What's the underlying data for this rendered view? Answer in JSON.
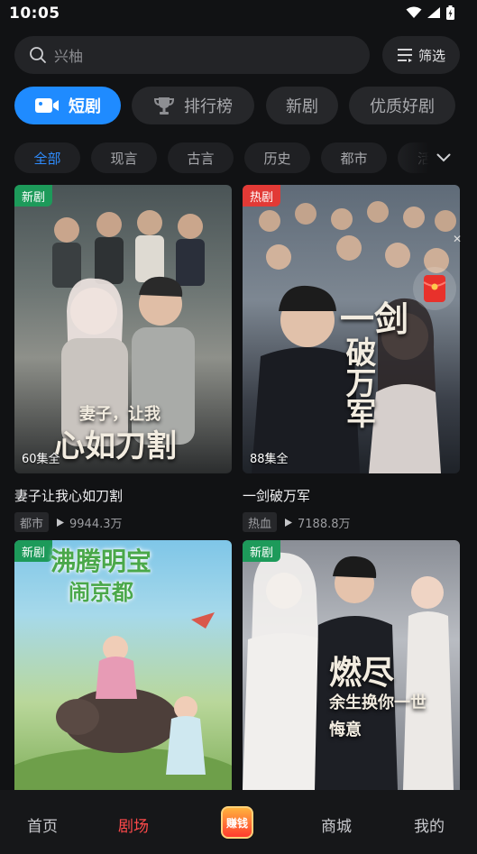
{
  "status": {
    "time": "10:05"
  },
  "search": {
    "placeholder": "兴柚",
    "filter_label": "筛选"
  },
  "categories": [
    {
      "label": "短剧",
      "active": true
    },
    {
      "label": "排行榜"
    },
    {
      "label": "新剧"
    },
    {
      "label": "优质好剧"
    }
  ],
  "tags": [
    "全部",
    "现言",
    "古言",
    "历史",
    "都市",
    "活"
  ],
  "cards": [
    {
      "badge": "新剧",
      "episodes": "60集全",
      "title": "妻子让我心如刀割",
      "genre": "都市",
      "plays": "9944.3万",
      "poster_line1": "妻子，让我",
      "poster_line2": "心如刀割"
    },
    {
      "badge": "热剧",
      "episodes": "88集全",
      "title": "一剑破万军",
      "genre": "热血",
      "plays": "7188.8万",
      "poster_line1": "一剑",
      "poster_line2": "破万军"
    },
    {
      "badge": "新剧",
      "poster_line1": "沸腾明宝",
      "poster_line2": "闹京都"
    },
    {
      "badge": "新剧",
      "poster_line1": "燃尽",
      "poster_line2": "余生换你一世悔意"
    }
  ],
  "nav": {
    "home": "首页",
    "theater": "剧场",
    "earn": "赚钱",
    "mall": "商城",
    "mine": "我的"
  },
  "colors": {
    "accent": "#1f8bff",
    "nav_active": "#ff4a4a",
    "badge_new": "#1d9a5a",
    "badge_hot": "#e23a36"
  }
}
